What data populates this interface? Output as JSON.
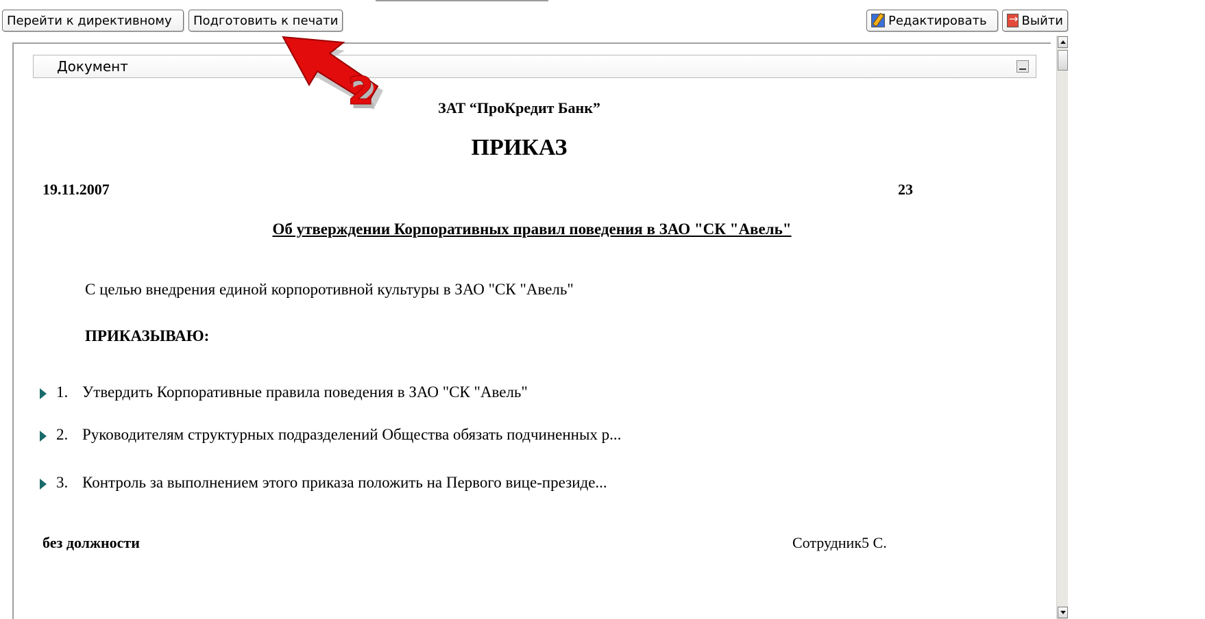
{
  "toolbar": {
    "go_directive_label": "Перейти к директивному",
    "prepare_print_label": "Подготовить к печати",
    "edit_label": "Редактировать",
    "exit_label": "Выйти"
  },
  "annotation": {
    "step_number": "2",
    "arrow_color": "#e20c0c"
  },
  "document": {
    "header_label": "Документ",
    "bank_name": "ЗАТ “ПроКредит Банк”",
    "title": "ПРИКАЗ",
    "date": "19.11.2007",
    "number": "23",
    "subject": "Об утверждении Корпоративных правил поведения в ЗАО \"СК \"Авель\"",
    "intro": "С целью внедрения единой корпоротивной культуры в ЗАО \"СК \"Авель\"",
    "order_word": "ПРИКАЗЫВАЮ:",
    "items": [
      {
        "num": "1.",
        "text": "Утвердить Корпоративные правила поведения в ЗАО \"СК \"Авель\""
      },
      {
        "num": "2.",
        "text": "Руководителям структурных подразделений Общества обязать подчиненных р..."
      },
      {
        "num": "3.",
        "text": "Контроль за выполнением этого приказа положить на Первого вице-президе..."
      }
    ],
    "signer_position": "без должности",
    "signer_name": "Сотрудник5 С."
  },
  "colors": {
    "bullet": "#1a6b6b",
    "scrollbar_track": "#e9e8e2"
  },
  "icons": {
    "edit": "edit-icon",
    "exit": "exit-icon",
    "collapse": "collapse-icon",
    "bullet": "bullet-triangle-icon"
  }
}
